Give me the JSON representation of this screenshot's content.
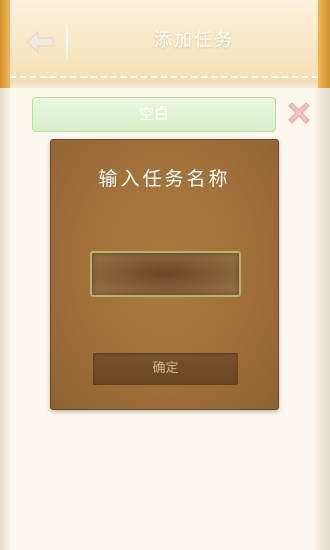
{
  "header": {
    "title": "添加任务",
    "back_icon": "back-arrow-icon"
  },
  "form": {
    "blank_field_value": "空白",
    "clear_icon": "close-x-icon"
  },
  "dialog": {
    "title": "输入任务名称",
    "name_input_value": "",
    "confirm_label": "确定"
  },
  "colors": {
    "header_accent": "#d58f2a",
    "dialog_background": "#a0703a",
    "blank_field_green": "#d9efc9",
    "clear_icon_pink": "#f2c0c0"
  }
}
